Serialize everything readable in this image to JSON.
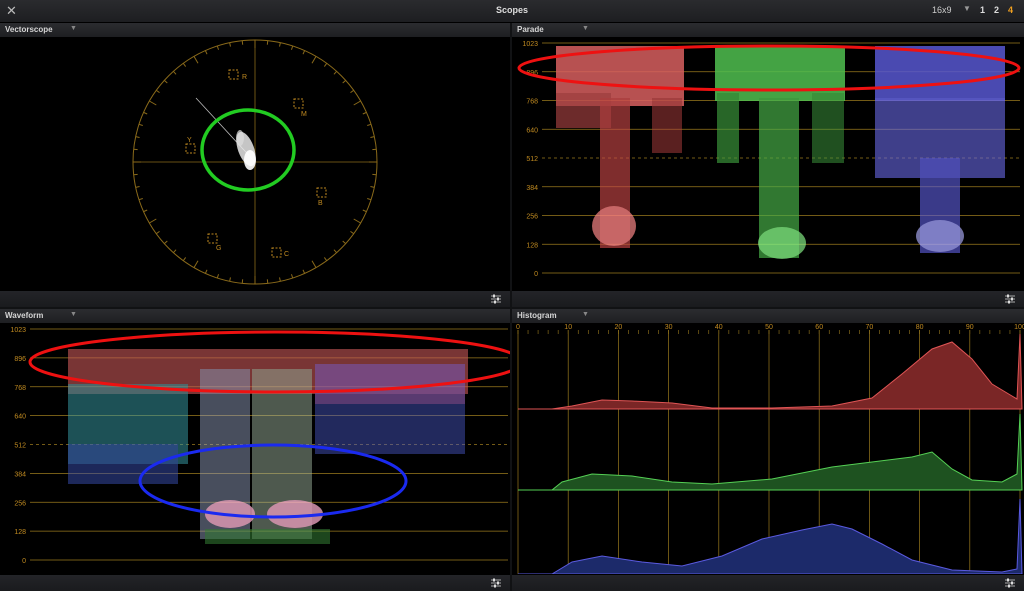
{
  "window": {
    "title": "Scopes",
    "aspect": "16x9",
    "layouts": [
      "1",
      "2",
      "4"
    ],
    "active_layout": "4"
  },
  "vectorscope": {
    "label": "Vectorscope",
    "targets": [
      "R",
      "M",
      "B",
      "C",
      "G",
      "Y"
    ]
  },
  "parade": {
    "label": "Parade",
    "scale": [
      "1023",
      "896",
      "768",
      "640",
      "512",
      "384",
      "256",
      "128",
      "0"
    ]
  },
  "waveform": {
    "label": "Waveform",
    "scale": [
      "1023",
      "896",
      "768",
      "640",
      "512",
      "384",
      "256",
      "128",
      "0"
    ]
  },
  "histogram": {
    "label": "Histogram",
    "scale": [
      "0",
      "10",
      "20",
      "30",
      "40",
      "50",
      "60",
      "70",
      "80",
      "90",
      "100"
    ]
  },
  "colors": {
    "accent": "#f0a020",
    "graticule": "#9a7a1e",
    "red": "#e05555",
    "green": "#55d055",
    "blue": "#5a5ae0"
  },
  "icons": [
    "close-icon",
    "chevron-down-icon",
    "sliders-icon"
  ]
}
